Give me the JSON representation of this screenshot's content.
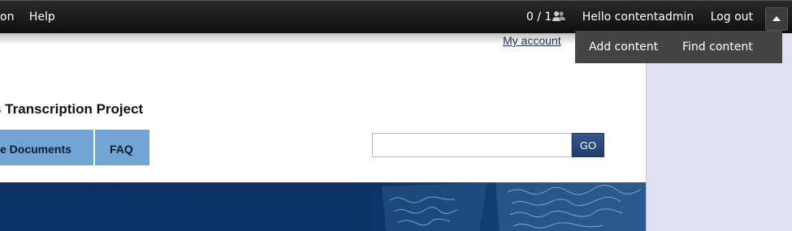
{
  "toolbar": {
    "menu_left": [
      "on",
      "Help"
    ],
    "counter": "0 / 1",
    "hello": "Hello contentadmin",
    "logout": "Log out"
  },
  "shortcuts": {
    "add": "Add content",
    "find": "Find content"
  },
  "header": {
    "my_account": "My account",
    "site_title": "s Transcription Project"
  },
  "nav": {
    "tab1": "e Documents",
    "tab2": "FAQ"
  },
  "search": {
    "value": "",
    "button": "GO"
  },
  "colors": {
    "toolbar": "#111111",
    "nav_tab": "#73a5d4",
    "banner": "#0d3366",
    "sidebar": "#dfe2f3"
  }
}
